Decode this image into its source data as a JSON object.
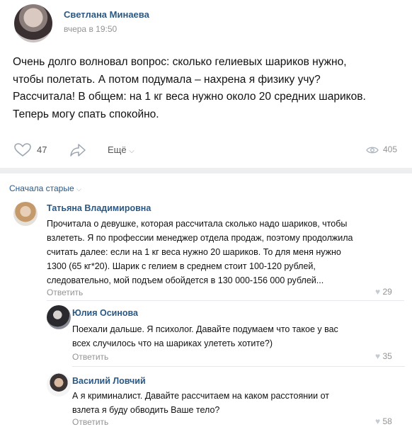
{
  "post": {
    "author": "Светлана Минаева",
    "date": "вчера в 19:50",
    "text_lines": [
      "Очень долго волновал вопрос: сколько гелиевых шариков нужно,",
      "чтобы полетать. А потом подумала – нахрена я физику учу?",
      "Рассчитала! В общем: на 1 кг веса нужно около 20 средних шариков.",
      "Теперь могу спать спокойно."
    ],
    "likes": "47",
    "more": "Ещё",
    "views": "405"
  },
  "comments_sort": "Сначала старые",
  "comments": [
    {
      "author": "Татьяна Владимировна",
      "text_lines": [
        "Прочитала о девушке, которая рассчитала сколько надо шариков, чтобы",
        "взлететь. Я по профессии менеджер отдела продаж, поэтому продолжила",
        "считать далее: если на 1 кг веса нужно 20 шариков. То для меня нужно",
        "1300 (65 кг*20). Шарик с гелием в среднем стоит 100-120 рублей,",
        "следовательно, мой подъем обойдется в 130 000-156 000 рублей..."
      ],
      "reply": "Ответить",
      "likes": "29"
    },
    {
      "author": "Юлия Осинова",
      "text_lines": [
        "Поехали дальше. Я психолог. Давайте подумаем что такое у вас",
        "всех случилось что на шариках улететь хотите?)"
      ],
      "reply": "Ответить",
      "likes": "35"
    },
    {
      "author": "Василий Ловчий",
      "text_lines": [
        "А я криминалист. Давайте рассчитаем на каком расстоянии от",
        "взлета я буду обводить Ваше тело?"
      ],
      "reply": "Ответить",
      "likes": "58"
    }
  ],
  "colors": {
    "link": "#2a5885",
    "muted": "#939393",
    "separator": "#edeef0"
  }
}
